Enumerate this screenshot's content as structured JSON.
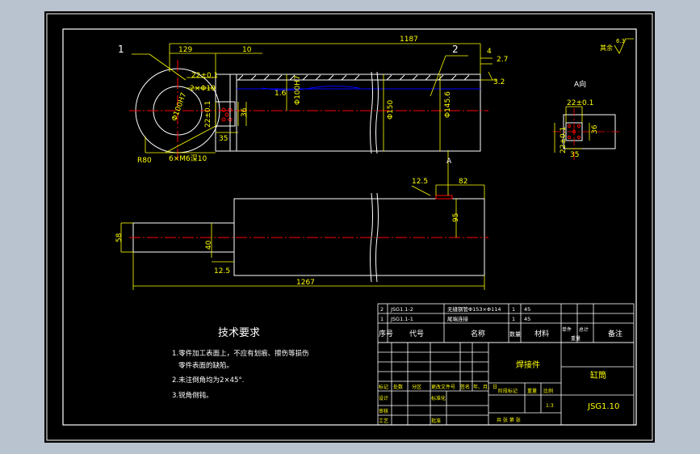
{
  "drawing": {
    "dimensions": {
      "d1187": "1187",
      "d129": "129",
      "d10": "10",
      "d4": "4",
      "d2_7": "2.7",
      "d3_2": "3.2",
      "d22": "22±0.1",
      "d2x10": "2×Φ10",
      "phi_left": "Φ100H7",
      "d35a": "35",
      "d36a": "36",
      "d6xm6": "6×M6深10",
      "r80": "R80",
      "d1_6": "1.6",
      "phi_mid": "Φ100H7",
      "phi150": "Φ150",
      "phi145": "Φ145.6",
      "view_a": "A向",
      "d22r": "22±0.1",
      "d22v": "22±0.1",
      "d35b": "35",
      "d36b": "36",
      "arrow_a": "A",
      "d12_5": "12.5",
      "d82": "82",
      "d95": "95",
      "d58": "58",
      "d40": "40",
      "d12_5b": "12.5",
      "d1267": "1267",
      "rough_other": "其余",
      "rough_val": "6.3",
      "balloon1": "1",
      "balloon2": "2"
    },
    "tech": {
      "title": "技术要求",
      "line1": "1.零件加工表面上，不应有划痕、擦伤等损伤",
      "line1b": "零件表面的缺陷。",
      "line2": "2.未注倒角均为2×45°.",
      "line3": "3.锐角倒钝。"
    },
    "bom": {
      "rows": [
        {
          "no": "2",
          "code": "JSG1.1-2",
          "name": "无缝钢管Φ153×Φ114",
          "qty": "1",
          "mat": "45"
        },
        {
          "no": "1",
          "code": "JSG1.1-1",
          "name": "尾端连接",
          "qty": "1",
          "mat": "45"
        }
      ],
      "head_no": "序号",
      "head_code": "代号",
      "head_name": "名称",
      "head_qty": "数量",
      "head_mat": "材料",
      "head_unit": "单件",
      "head_total": "总计",
      "head_weight": "重量",
      "head_note": "备注"
    },
    "titleblock": {
      "part_name": "焊接件",
      "company": "缸筒",
      "drawing_no": "JSG1.10",
      "mark": "标记",
      "count": "处数",
      "zone": "分区",
      "change_doc": "更改文件号",
      "sign": "签名",
      "date": "年、月、日",
      "design": "设计",
      "std": "标准化",
      "stage": "阶段标记",
      "weight": "重量",
      "scale": "比例",
      "scale_val": "1:3",
      "review": "审核",
      "process": "工艺",
      "approve": "批准",
      "sheets": "共    张    第    张",
      "standardize": "标准化"
    }
  }
}
